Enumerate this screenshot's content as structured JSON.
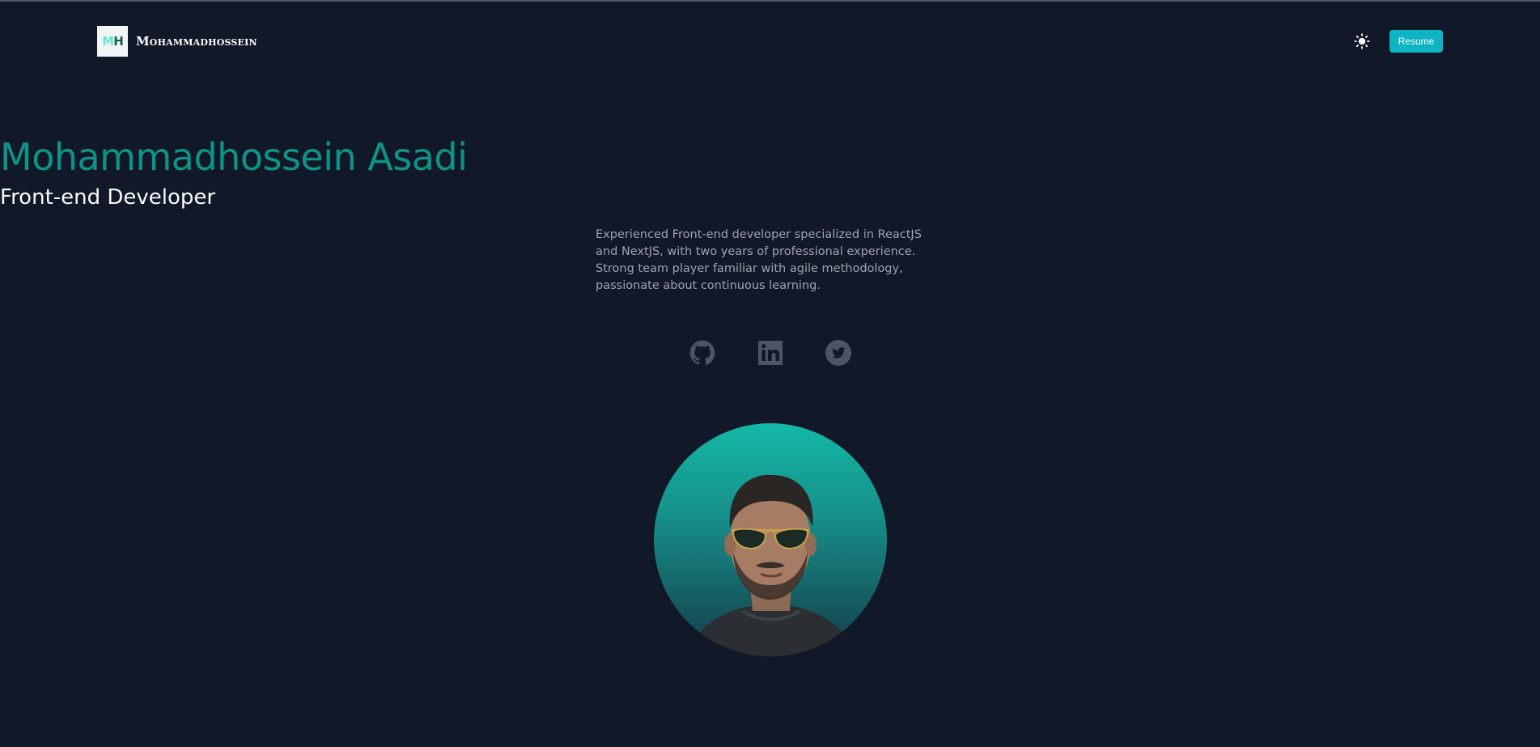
{
  "header": {
    "logo_monogram_m": "M",
    "logo_monogram_h": "H",
    "brand_name": "Mohammadhossein",
    "theme_toggle_icon": "sun-icon",
    "resume_label": "Resume"
  },
  "hero": {
    "name": "Mohammadhossein Asadi",
    "role": "Front-end Developer",
    "description": "Experienced Front-end developer specialized in ReactJS and NextJS, with two years of professional experience. Strong team player familiar with agile methodology, passionate about continuous learning."
  },
  "socials": [
    {
      "icon": "github-icon"
    },
    {
      "icon": "linkedin-icon"
    },
    {
      "icon": "twitter-icon"
    }
  ],
  "colors": {
    "background": "#111827",
    "accent": "#0d9488",
    "button": "#0fb4c4",
    "social_icon": "#4b5563"
  }
}
